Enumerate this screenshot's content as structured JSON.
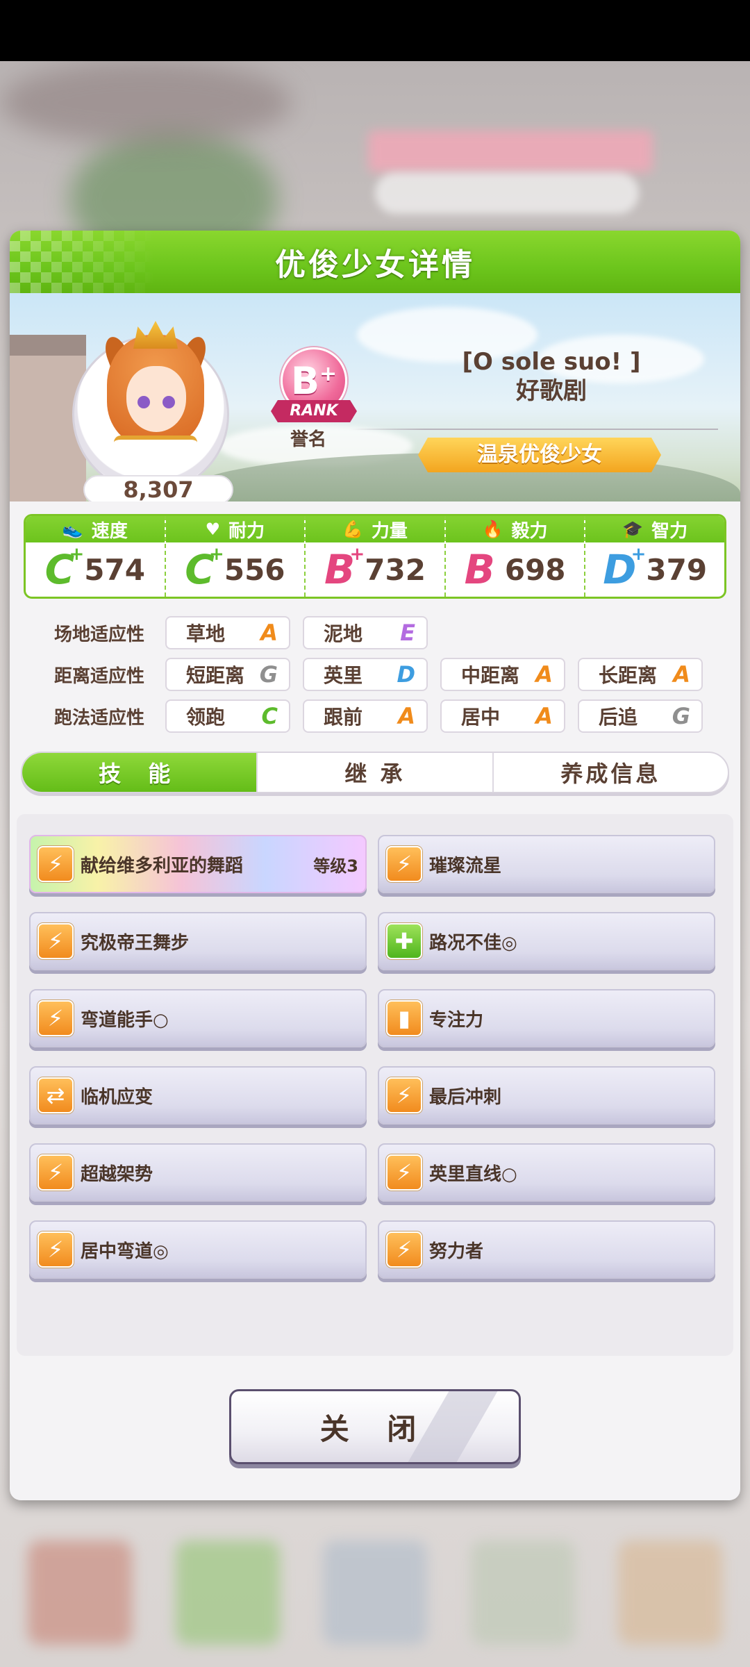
{
  "dialog": {
    "title": "优俊少女详情"
  },
  "profile": {
    "fans": "8,307",
    "rank_letter": "B",
    "rank_plus": "+",
    "rank_ribbon": "RANK",
    "rank_label": "誉名",
    "epithet_line1": "[O sole suo! ]",
    "epithet_line2": "好歌剧",
    "title_tag": "温泉优俊少女"
  },
  "stats": [
    {
      "name": "速度",
      "icon": "shoe-icon",
      "grade": "C",
      "plus": "+",
      "value": "574",
      "color": "#5dbb2c"
    },
    {
      "name": "耐力",
      "icon": "heart-icon",
      "grade": "C",
      "plus": "+",
      "value": "556",
      "color": "#5dbb2c"
    },
    {
      "name": "力量",
      "icon": "muscle-icon",
      "grade": "B",
      "plus": "+",
      "value": "732",
      "color": "#e4467f"
    },
    {
      "name": "毅力",
      "icon": "flame-icon",
      "grade": "B",
      "plus": "",
      "value": "698",
      "color": "#e4467f"
    },
    {
      "name": "智力",
      "icon": "graduation-cap-icon",
      "grade": "D",
      "plus": "+",
      "value": "379",
      "color": "#3d9de0"
    }
  ],
  "aptitude": {
    "track": {
      "label": "场地适应性",
      "items": [
        {
          "name": "草地",
          "grade": "A"
        },
        {
          "name": "泥地",
          "grade": "E"
        }
      ]
    },
    "distance": {
      "label": "距离适应性",
      "items": [
        {
          "name": "短距离",
          "grade": "G"
        },
        {
          "name": "英里",
          "grade": "D"
        },
        {
          "name": "中距离",
          "grade": "A"
        },
        {
          "name": "长距离",
          "grade": "A"
        }
      ]
    },
    "style": {
      "label": "跑法适应性",
      "items": [
        {
          "name": "领跑",
          "grade": "C"
        },
        {
          "name": "跟前",
          "grade": "A"
        },
        {
          "name": "居中",
          "grade": "A"
        },
        {
          "name": "后追",
          "grade": "G"
        }
      ]
    }
  },
  "tabs": [
    {
      "label": "技 能",
      "active": true
    },
    {
      "label": "继 承",
      "active": false
    },
    {
      "label": "养成信息",
      "active": false
    }
  ],
  "skills": [
    {
      "name": "献给维多利亚的舞蹈",
      "level": "等级3",
      "icon": "orange",
      "rare": true
    },
    {
      "name": "璀璨流星",
      "icon": "orange"
    },
    {
      "name": "究极帝王舞步",
      "icon": "orange"
    },
    {
      "name": "路况不佳◎",
      "icon": "green"
    },
    {
      "name": "弯道能手○",
      "icon": "orange"
    },
    {
      "name": "专注力",
      "icon": "orange"
    },
    {
      "name": "临机应变",
      "icon": "orange"
    },
    {
      "name": "最后冲刺",
      "icon": "orange"
    },
    {
      "name": "超越架势",
      "icon": "orange"
    },
    {
      "name": "英里直线○",
      "icon": "orange"
    },
    {
      "name": "居中弯道◎",
      "icon": "orange"
    },
    {
      "name": "努力者",
      "icon": "orange"
    }
  ],
  "close_label": "关 闭"
}
